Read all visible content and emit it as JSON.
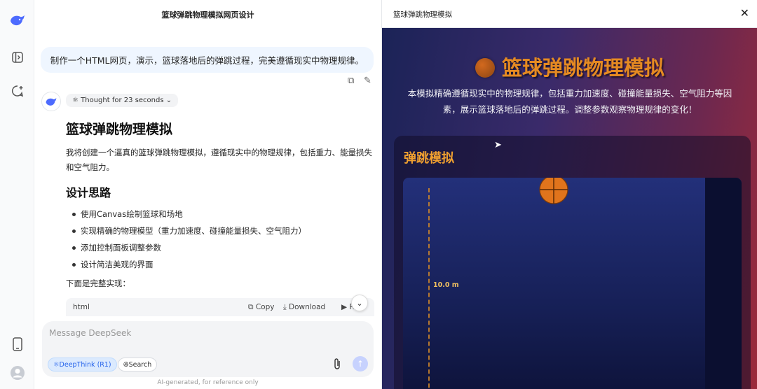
{
  "sidebar": {
    "icons": [
      "deepseek-whale-logo",
      "open-sidebar-icon",
      "new-chat-icon",
      "mobile-app-icon",
      "user-avatar-icon"
    ]
  },
  "chat": {
    "title": "篮球弹跳物理模拟网页设计",
    "user_message": "制作一个HTML网页，演示，篮球落地后的弹跳过程，完美遵循现实中物理规律。",
    "thought_label": "Thought for 23 seconds",
    "answer_title": "篮球弹跳物理模拟",
    "answer_intro": "我将创建一个逼真的篮球弹跳物理模拟，遵循现实中的物理规律，包括重力、能量损失和空气阻力。",
    "design_heading": "设计思路",
    "bullets": [
      "使用Canvas绘制篮球和场地",
      "实现精确的物理模型（重力加速度、碰撞能量损失、空气阻力）",
      "添加控制面板调整参数",
      "设计简洁美观的界面"
    ],
    "impl_label": "下面是完整实现：",
    "code_lang": "html",
    "copy_label": "Copy",
    "download_label": "Download",
    "run_label": "R",
    "input_placeholder": "Message DeepSeek",
    "deepthink_label": "DeepThink (R1)",
    "search_label": "Search",
    "disclaimer": "AI-generated, for reference only"
  },
  "preview": {
    "panel_title": "篮球弹跳物理模拟",
    "page_title": "篮球弹跳物理模拟",
    "description": "本模拟精确遵循现实中的物理规律，包括重力加速度、碰撞能量损失、空气阻力等因素，展示篮球落地后的弹跳过程。调整参数观察物理规律的变化！",
    "card_title": "弹跳模拟",
    "height_label": "10.0 m"
  },
  "colors": {
    "accent_blue": "#2563eb",
    "title_orange": "#e58a22",
    "card_title_orange": "#f0a030",
    "ball_orange": "#e0741c"
  }
}
